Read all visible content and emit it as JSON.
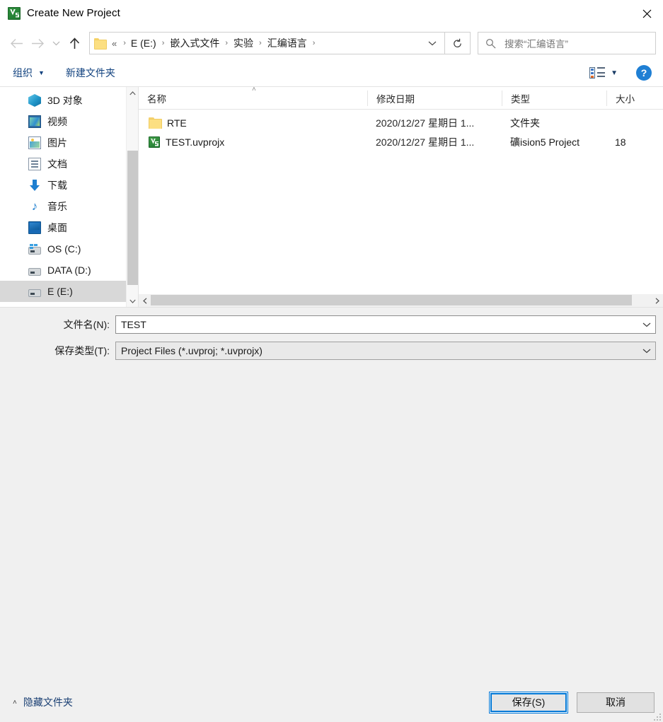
{
  "window": {
    "title": "Create New Project",
    "app_icon": "keil-uvision-icon",
    "close_label": "✕"
  },
  "nav": {
    "back_icon": "back-arrow-icon",
    "forward_icon": "forward-arrow-icon",
    "recent_icon": "chevron-down-icon",
    "up_icon": "up-arrow-icon",
    "refresh_icon": "refresh-icon",
    "dropdown_icon": "chevron-down-icon"
  },
  "address": {
    "folder_icon": "folder-icon",
    "overflow": "«",
    "crumbs": [
      "E (E:)",
      "嵌入式文件",
      "实验",
      "汇编语言"
    ],
    "separator": "›"
  },
  "search": {
    "icon": "search-icon",
    "placeholder": "搜索“汇编语言”"
  },
  "toolbar": {
    "organize_label": "组织",
    "organize_caret": "▼",
    "new_folder_label": "新建文件夹",
    "view_icon": "view-layout-icon",
    "view_caret": "▼",
    "help_label": "?"
  },
  "sidebar": {
    "items": [
      {
        "label": "3D 对象",
        "icon": "3d-objects-icon",
        "selected": false
      },
      {
        "label": "视频",
        "icon": "videos-icon",
        "selected": false
      },
      {
        "label": "图片",
        "icon": "pictures-icon",
        "selected": false
      },
      {
        "label": "文档",
        "icon": "documents-icon",
        "selected": false
      },
      {
        "label": "下载",
        "icon": "downloads-icon",
        "selected": false
      },
      {
        "label": "音乐",
        "icon": "music-icon",
        "selected": false
      },
      {
        "label": "桌面",
        "icon": "desktop-icon",
        "selected": false
      },
      {
        "label": "OS (C:)",
        "icon": "drive-os-icon",
        "selected": false
      },
      {
        "label": "DATA (D:)",
        "icon": "drive-icon",
        "selected": false
      },
      {
        "label": "E (E:)",
        "icon": "drive-icon",
        "selected": true
      }
    ],
    "scroll_up_icon": "chevron-up-icon",
    "scroll_down_icon": "chevron-down-icon"
  },
  "filelist": {
    "columns": [
      {
        "key": "name",
        "label": "名称",
        "sorted": "asc",
        "sort_caret": "˄"
      },
      {
        "key": "date",
        "label": "修改日期"
      },
      {
        "key": "type",
        "label": "类型"
      },
      {
        "key": "size",
        "label": "大小"
      }
    ],
    "rows": [
      {
        "name": "RTE",
        "icon": "folder-icon",
        "date": "2020/12/27 星期日 1...",
        "type": "文件夹",
        "size": ""
      },
      {
        "name": "TEST.uvprojx",
        "icon": "keil-uvision-icon",
        "date": "2020/12/27 星期日 1...",
        "type": "礦ision5 Project",
        "size": "18"
      }
    ],
    "hscroll_left_icon": "chevron-left-icon",
    "hscroll_right_icon": "chevron-right-icon"
  },
  "form": {
    "filename_label": "文件名(N):",
    "filename_value": "TEST",
    "filetype_label": "保存类型(T):",
    "filetype_value": "Project Files (*.uvproj; *.uvprojx)",
    "combo_arrow": "⌄"
  },
  "footer": {
    "hide_folders_caret": "˄",
    "hide_folders_label": "隐藏文件夹",
    "save_label": "保存(S)",
    "cancel_label": "取消"
  },
  "colors": {
    "accent": "#0078d7",
    "link": "#11427f",
    "selection": "#d8d8d8",
    "panel": "#f0f0f0"
  }
}
